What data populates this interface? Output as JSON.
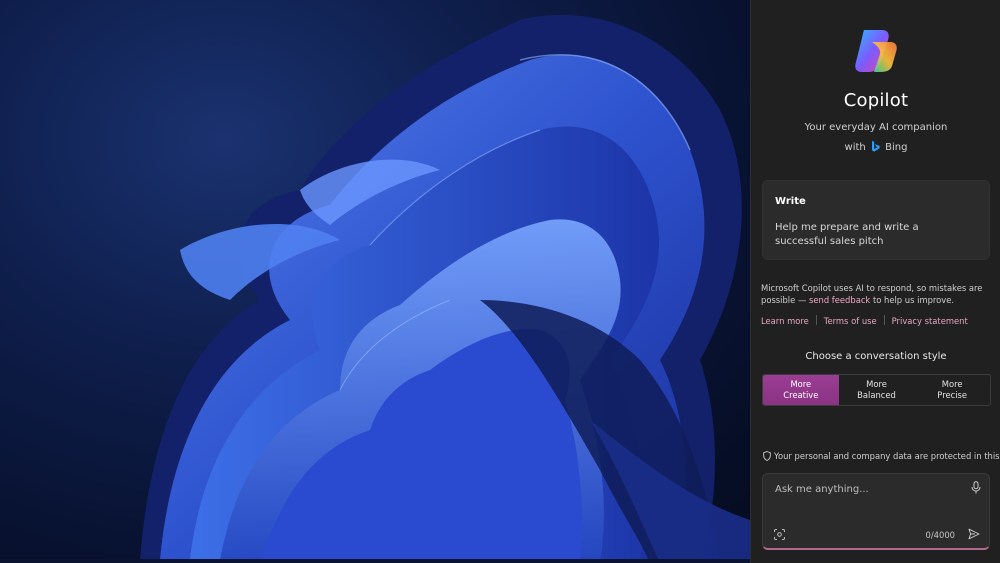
{
  "wallpaper": {
    "description_icon": "windows-bloom-wallpaper"
  },
  "copilot": {
    "logo_icon": "copilot-logo-icon",
    "title": "Copilot",
    "subtitle": "Your everyday AI companion",
    "with_prefix": "with",
    "with_brand": "Bing",
    "bing_icon": "bing-icon"
  },
  "prompt_card": {
    "label": "Write",
    "text": "Help me prepare and write a successful sales pitch"
  },
  "disclaimer": {
    "text_before": "Microsoft Copilot uses AI to respond, so mistakes are possible — ",
    "feedback_link": "send feedback",
    "text_after": " to help us improve."
  },
  "links": [
    "Learn more",
    "Terms of use",
    "Privacy statement"
  ],
  "conversation_style": {
    "heading": "Choose a conversation style",
    "options": [
      {
        "line1": "More",
        "line2": "Creative",
        "active": true
      },
      {
        "line1": "More",
        "line2": "Balanced",
        "active": false
      },
      {
        "line1": "More",
        "line2": "Precise",
        "active": false
      }
    ]
  },
  "privacy_note": "Your personal and company data are protected in this chat",
  "input": {
    "placeholder": "Ask me anything...",
    "char_count": "0/4000"
  },
  "colors": {
    "panel_bg": "#202020",
    "accent_active": "#9b3d94",
    "link_pink": "#e9a6c5"
  }
}
